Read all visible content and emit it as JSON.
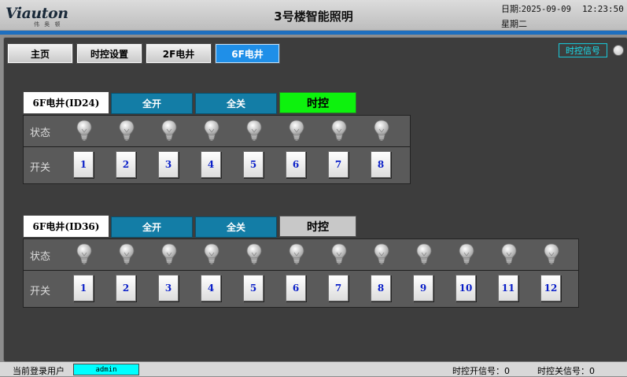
{
  "header": {
    "logo_text": "Viauton",
    "logo_sub": "伟 奥 顿",
    "title": "3号楼智能照明",
    "date_label": "日期:",
    "date": "2025-09-09",
    "time": "12:23:50",
    "weekday": "星期二"
  },
  "nav": {
    "tabs": [
      {
        "label": "主页"
      },
      {
        "label": "时控设置"
      },
      {
        "label": "2F电井"
      },
      {
        "label": "6F电井",
        "active": true
      }
    ]
  },
  "signal_badge": "时控信号",
  "row_labels": {
    "status": "状态",
    "switch": "开关"
  },
  "panels": [
    {
      "title": "6F电井(ID24)",
      "all_on": "全开",
      "all_off": "全关",
      "timer": "时控",
      "timer_active": true,
      "switches": [
        "1",
        "2",
        "3",
        "4",
        "5",
        "6",
        "7",
        "8"
      ]
    },
    {
      "title": "6F电井(ID36)",
      "all_on": "全开",
      "all_off": "全关",
      "timer": "时控",
      "timer_active": false,
      "switches": [
        "1",
        "2",
        "3",
        "4",
        "5",
        "6",
        "7",
        "8",
        "9",
        "10",
        "11",
        "12"
      ]
    }
  ],
  "status_bar": {
    "user_label": "当前登录用户",
    "user": "admin",
    "timer_on_signal": "时控开信号：0",
    "timer_off_signal": "时控关信号：0"
  },
  "colors": {
    "active_tab": "#1f8fe8",
    "panel_button": "#137da6",
    "timer_on": "#0df20d",
    "signal_badge": "#19e0ef",
    "switch_number": "#0a1fc8"
  },
  "icons": {
    "bulb": "light-bulb-icon"
  }
}
